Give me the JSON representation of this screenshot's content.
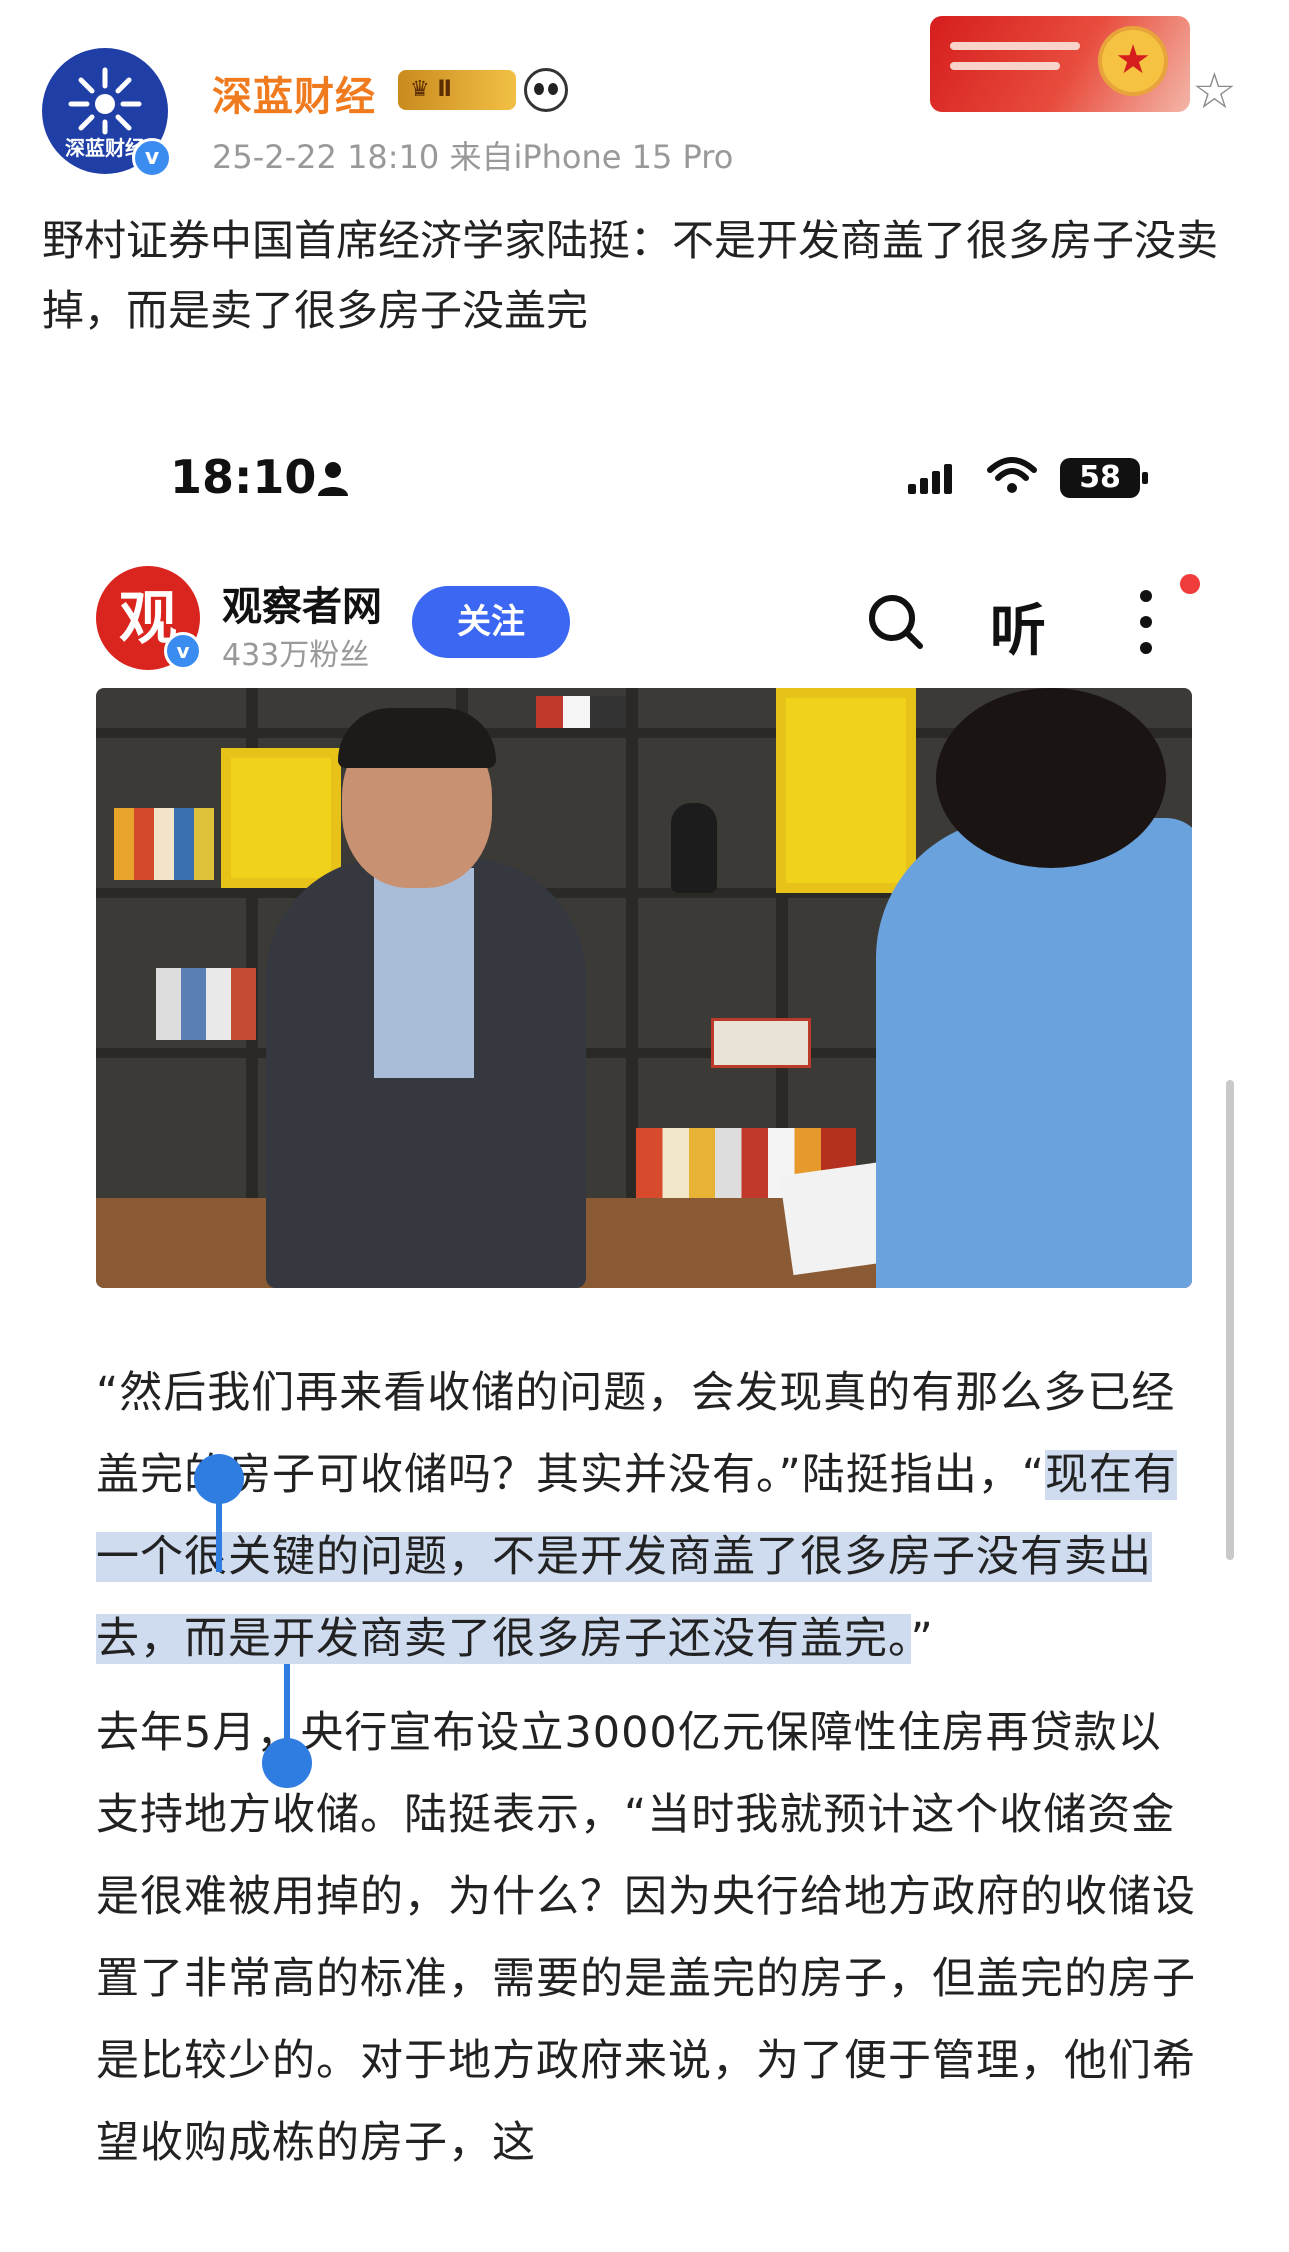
{
  "post": {
    "author": "深蓝财经",
    "avatar_text": "深蓝财经",
    "vip_label": "Ⅱ",
    "verified_mark": "v",
    "timestamp": "25-2-22 18:10",
    "source": "来自iPhone 15 Pro",
    "text": "野村证券中国首席经济学家陆挺：不是开发商盖了很多房子没卖掉，而是卖了很多房子没盖完",
    "icons": [
      "panda-icon",
      "star-icon",
      "banner"
    ]
  },
  "phone": {
    "status_time": "18:10",
    "battery": "58"
  },
  "account": {
    "logo": "观",
    "name": "观察者网",
    "fans": "433万粉丝",
    "follow_label": "关注",
    "listen_label": "听"
  },
  "article": {
    "p1_before": "“然后我们再来看收储的问题，会发现真的有那么多已经盖完的房子可收储吗？其实并没有。”陆挺指出，“",
    "p1_highlight": "现在有一个很关键的问题，不是开发商盖了很多房子没有卖出去，而是开发商卖了很多房子还没有盖完。",
    "p1_after": "”",
    "p2": "去年5月，央行宣布设立3000亿元保障性住房再贷款以支持地方收储。陆挺表示，“当时我就预计这个收储资金是很难被用掉的，为什么？因为央行给地方政府的收储设置了非常高的标准，需要的是盖完的房子，但盖完的房子是比较少的。对于地方政府来说，为了便于管理，他们希望收购成栋的房子，这"
  },
  "colors": {
    "username": "#f07a1e",
    "follow_button": "#3b67f2",
    "selection": "#cfdcf0",
    "handle": "#2f7de1"
  }
}
